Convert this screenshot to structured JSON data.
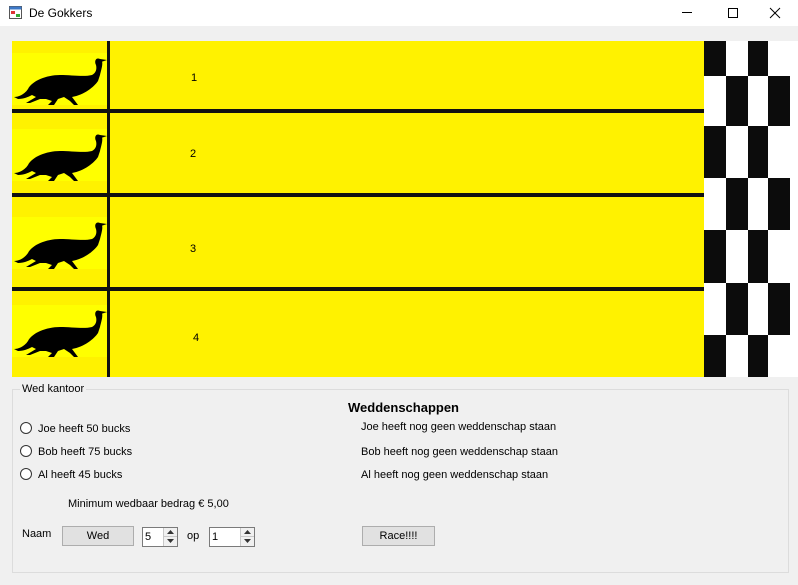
{
  "window": {
    "title": "De Gokkers"
  },
  "track": {
    "lanes": [
      {
        "number": "1"
      },
      {
        "number": "2"
      },
      {
        "number": "3"
      },
      {
        "number": "4"
      }
    ]
  },
  "betting_office": {
    "group_title": "Wed kantoor",
    "heading": "Weddenschappen",
    "bettors": [
      {
        "label": "Joe heeft 50 bucks",
        "bet_status": "Joe heeft nog geen weddenschap staan"
      },
      {
        "label": "Bob heeft 75 bucks",
        "bet_status": "Bob heeft nog geen weddenschap staan"
      },
      {
        "label": "Al heeft 45 bucks",
        "bet_status": "Al heeft nog geen weddenschap staan"
      }
    ],
    "min_bet_text": "Minimum wedbaar bedrag € 5,00",
    "name_label": "Naam",
    "bet_button": "Wed",
    "amount_value": "5",
    "op_label": "op",
    "runner_value": "1",
    "race_button": "Race!!!!"
  },
  "colors": {
    "lane": "#fff200",
    "runner_bg": "#ffff00",
    "divider": "#111111"
  },
  "icons": {
    "app": "app-window-icon",
    "minimize": "minimize-icon",
    "maximize": "maximize-icon",
    "close": "close-icon",
    "runner": "ostrich-silhouette-icon"
  }
}
